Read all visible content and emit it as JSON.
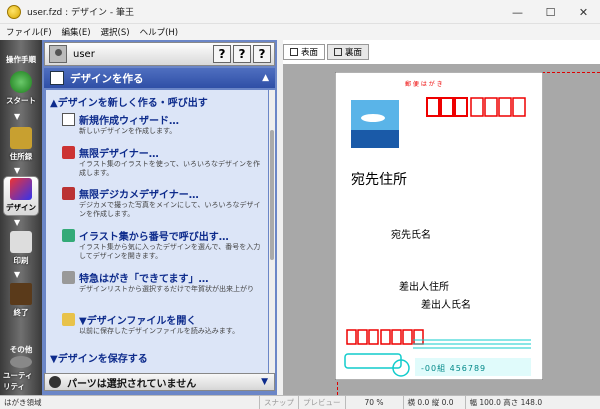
{
  "window": {
    "title": "user.fzd : デザイン - 筆王",
    "minimize": "—",
    "maximize": "☐",
    "close": "✕"
  },
  "menu": [
    "ファイル(F)",
    "編集(E)",
    "選択(S)",
    "ヘルプ(H)"
  ],
  "leftbar": {
    "heading": "操作手順",
    "start": "スタート",
    "address": "住所録",
    "design": "デザイン",
    "print": "印刷",
    "end": "終了",
    "other": "その他",
    "utility": "ユーティリティ"
  },
  "panel": {
    "user": "user",
    "section": "デザインを作る",
    "groups": [
      {
        "title": "▲デザインを新しく作る・呼び出す"
      },
      {
        "title": "▼デザインファイルを開く"
      },
      {
        "title": "▼デザインを保存する"
      }
    ],
    "items": [
      {
        "title": "新規作成ウィザード…",
        "desc": "新しいデザインを作成します。"
      },
      {
        "title": "無限デザイナー…",
        "desc": "イラスト集のイラストを使って、いろいろなデザインを作成します。"
      },
      {
        "title": "無限デジカメデザイナー…",
        "desc": "デジカメで撮った写真をメインにして、いろいろなデザインを作成します。"
      },
      {
        "title": "イラスト集から番号で呼び出す…",
        "desc": "イラスト集から気に入ったデザインを選んで、番号を入力してデザインを開きます。"
      },
      {
        "title": "特急はがき「できてます」…",
        "desc": "デザインリストから選択するだけで年賀状が出来上がり"
      },
      {
        "title": "▼デザインファイルを開く",
        "desc": "以前に保存したデザインファイルを読み込みます。"
      }
    ],
    "footer": "パーツは選択されていません"
  },
  "tabs": [
    "表面",
    "裏面"
  ],
  "card": {
    "label": "郵 便 は が き",
    "recipient_address": "宛先住所",
    "recipient_name": "宛先氏名",
    "sender_address": "差出人住所",
    "sender_name": "差出人氏名",
    "barcode": "-00組 456789"
  },
  "status": {
    "area": "はがき領域",
    "snap": "スナップ",
    "preview": "プレビュー",
    "zoom": "70 %",
    "pos": "横 0.0 縦 0.0",
    "size": "幅 100.0 高さ 148.0"
  }
}
